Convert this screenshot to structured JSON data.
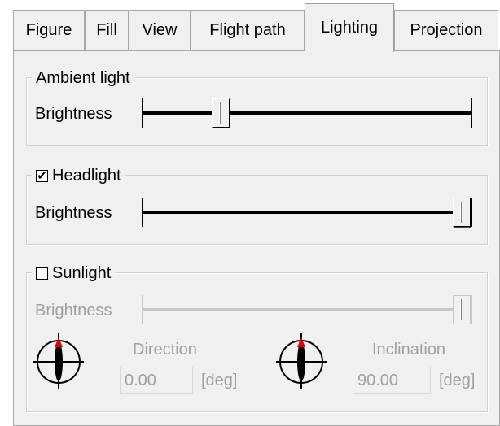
{
  "tabs": [
    {
      "label": "Figure",
      "active": false
    },
    {
      "label": "Fill",
      "active": false
    },
    {
      "label": "View",
      "active": false
    },
    {
      "label": "Flight path",
      "active": false
    },
    {
      "label": "Lighting",
      "active": true
    },
    {
      "label": "Projection",
      "active": false
    }
  ],
  "ambient": {
    "title": "Ambient light",
    "brightness_label": "Brightness",
    "brightness_value": 0.22
  },
  "headlight": {
    "title": "Headlight",
    "checked": true,
    "check_glyph": "✔",
    "brightness_label": "Brightness",
    "brightness_value": 1.0
  },
  "sunlight": {
    "title": "Sunlight",
    "checked": false,
    "enabled": false,
    "brightness_label": "Brightness",
    "brightness_value": 1.0,
    "direction": {
      "label": "Direction",
      "value": "0.00",
      "unit": "[deg]",
      "icon": "compass-icon"
    },
    "inclination": {
      "label": "Inclination",
      "value": "90.00",
      "unit": "[deg]",
      "icon": "compass-icon"
    }
  },
  "colors": {
    "panel": "#f0f0f0",
    "disabled_text": "#a0a0a0",
    "needle_tip": "#e00000"
  }
}
